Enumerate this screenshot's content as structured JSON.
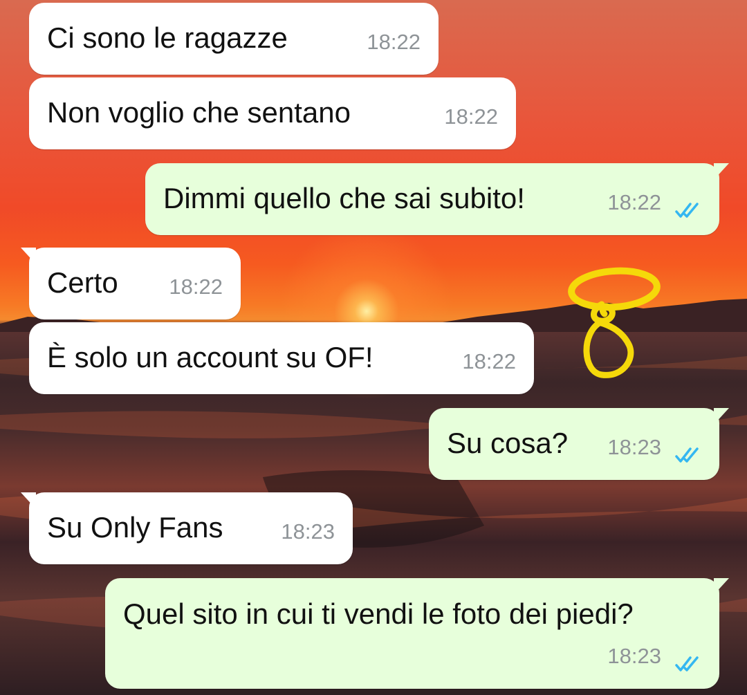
{
  "messages": [
    {
      "direction": "in",
      "text": "Ci sono le ragazze",
      "time": "18:22"
    },
    {
      "direction": "in",
      "text": "Non voglio che sentano",
      "time": "18:22"
    },
    {
      "direction": "out",
      "text": "Dimmi quello che sai subito!",
      "time": "18:22",
      "status": "read"
    },
    {
      "direction": "in",
      "text": "Certo",
      "time": "18:22"
    },
    {
      "direction": "in",
      "text": "È solo un account su OF!",
      "time": "18:22"
    },
    {
      "direction": "out",
      "text": "Su cosa?",
      "time": "18:23",
      "status": "read"
    },
    {
      "direction": "in",
      "text": "Su Only Fans",
      "time": "18:23"
    },
    {
      "direction": "out",
      "text": "Quel sito in cui ti vendi le foto dei piedi?",
      "time": "18:23",
      "status": "read"
    }
  ],
  "icons": {
    "read_receipt": "double-check-icon",
    "doodle": "yellow-marker-doodle"
  },
  "colors": {
    "incoming_bubble": "#ffffff",
    "outgoing_bubble": "#e7ffdb",
    "timestamp": "#8e9397",
    "read_ticks": "#34b7f1",
    "doodle": "#f5d90a"
  }
}
